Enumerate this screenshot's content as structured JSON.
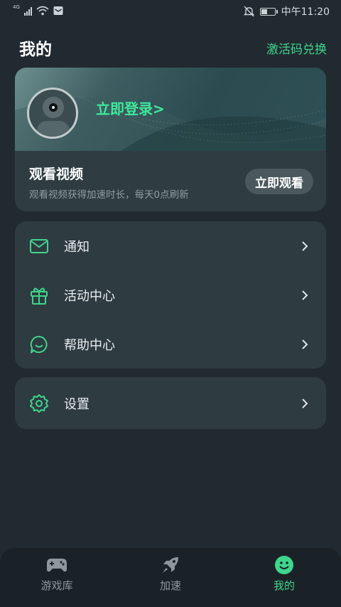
{
  "status_bar": {
    "network": "4G",
    "time": "中午11:20"
  },
  "header": {
    "title": "我的",
    "activation_link": "激活码兑换"
  },
  "profile": {
    "login_link": "立即登录>",
    "video_title": "观看视频",
    "video_desc": "观看视频获得加速时长，每天0点刷新",
    "watch_button": "立即观看"
  },
  "menu": {
    "group1": [
      {
        "label": "通知",
        "icon": "mail-icon"
      },
      {
        "label": "活动中心",
        "icon": "gift-icon"
      },
      {
        "label": "帮助中心",
        "icon": "chat-smile-icon"
      }
    ],
    "group2": [
      {
        "label": "设置",
        "icon": "gear-icon"
      }
    ]
  },
  "bottom_nav": [
    {
      "label": "游戏库",
      "icon": "gamepad-icon",
      "active": false
    },
    {
      "label": "加速",
      "icon": "rocket-icon",
      "active": false
    },
    {
      "label": "我的",
      "icon": "smile-face-icon",
      "active": true
    }
  ],
  "colors": {
    "accent": "#3fd58c",
    "background": "#212a30",
    "card": "#2e3b41"
  }
}
